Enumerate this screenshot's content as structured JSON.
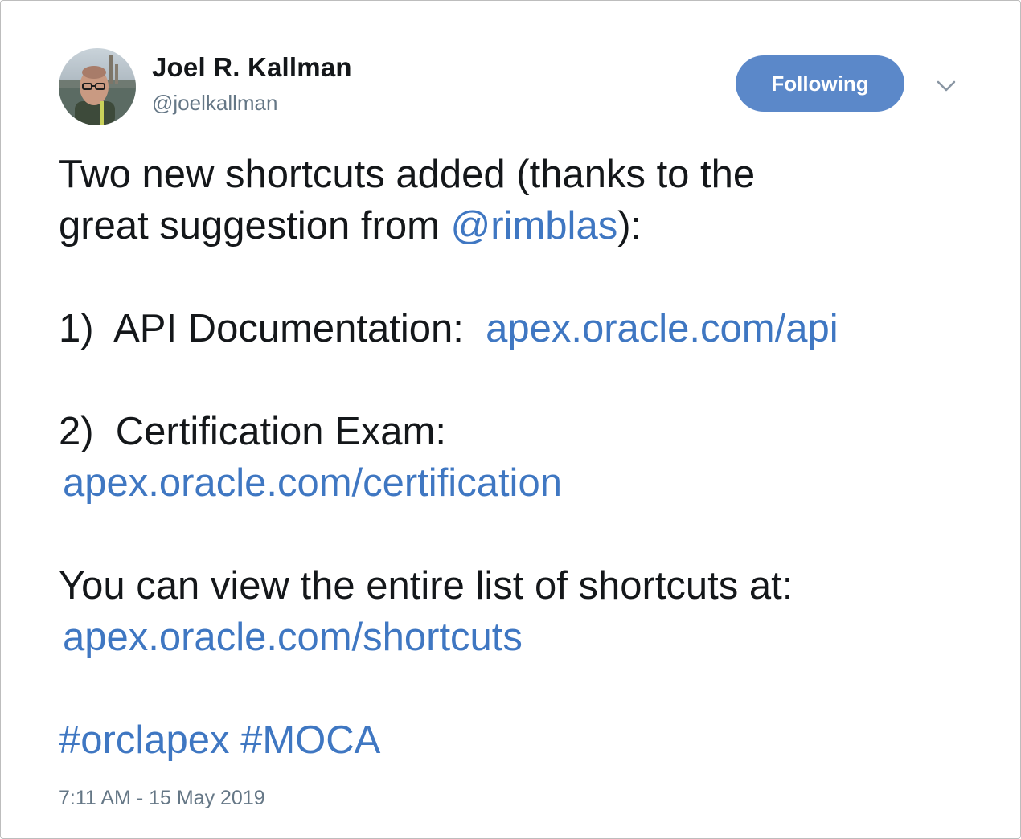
{
  "author": {
    "name": "Joel R. Kallman",
    "handle": "@joelkallman",
    "avatar_icon": "profile-photo"
  },
  "follow_button": {
    "label": "Following",
    "color": "#5b88c9"
  },
  "menu": {
    "icon": "chevron-down-icon"
  },
  "tweet": {
    "line1": "Two new shortcuts added (thanks to the",
    "line2_prefix": "great suggestion from ",
    "mention": "@rimblas",
    "line2_suffix": "):",
    "item1_label": "1)  API Documentation:  ",
    "item1_link": "apex.oracle.com/api",
    "item2_label": "2)  Certification Exam:",
    "item2_link": "apex.oracle.com/certification",
    "list_intro": "You can view the entire list of shortcuts at:",
    "list_link": "apex.oracle.com/shortcuts",
    "hashtag1": "#orclapex",
    "hashtag2": "#MOCA",
    "link_color": "#3f77c2"
  },
  "timestamp": "7:11 AM - 15 May 2019"
}
